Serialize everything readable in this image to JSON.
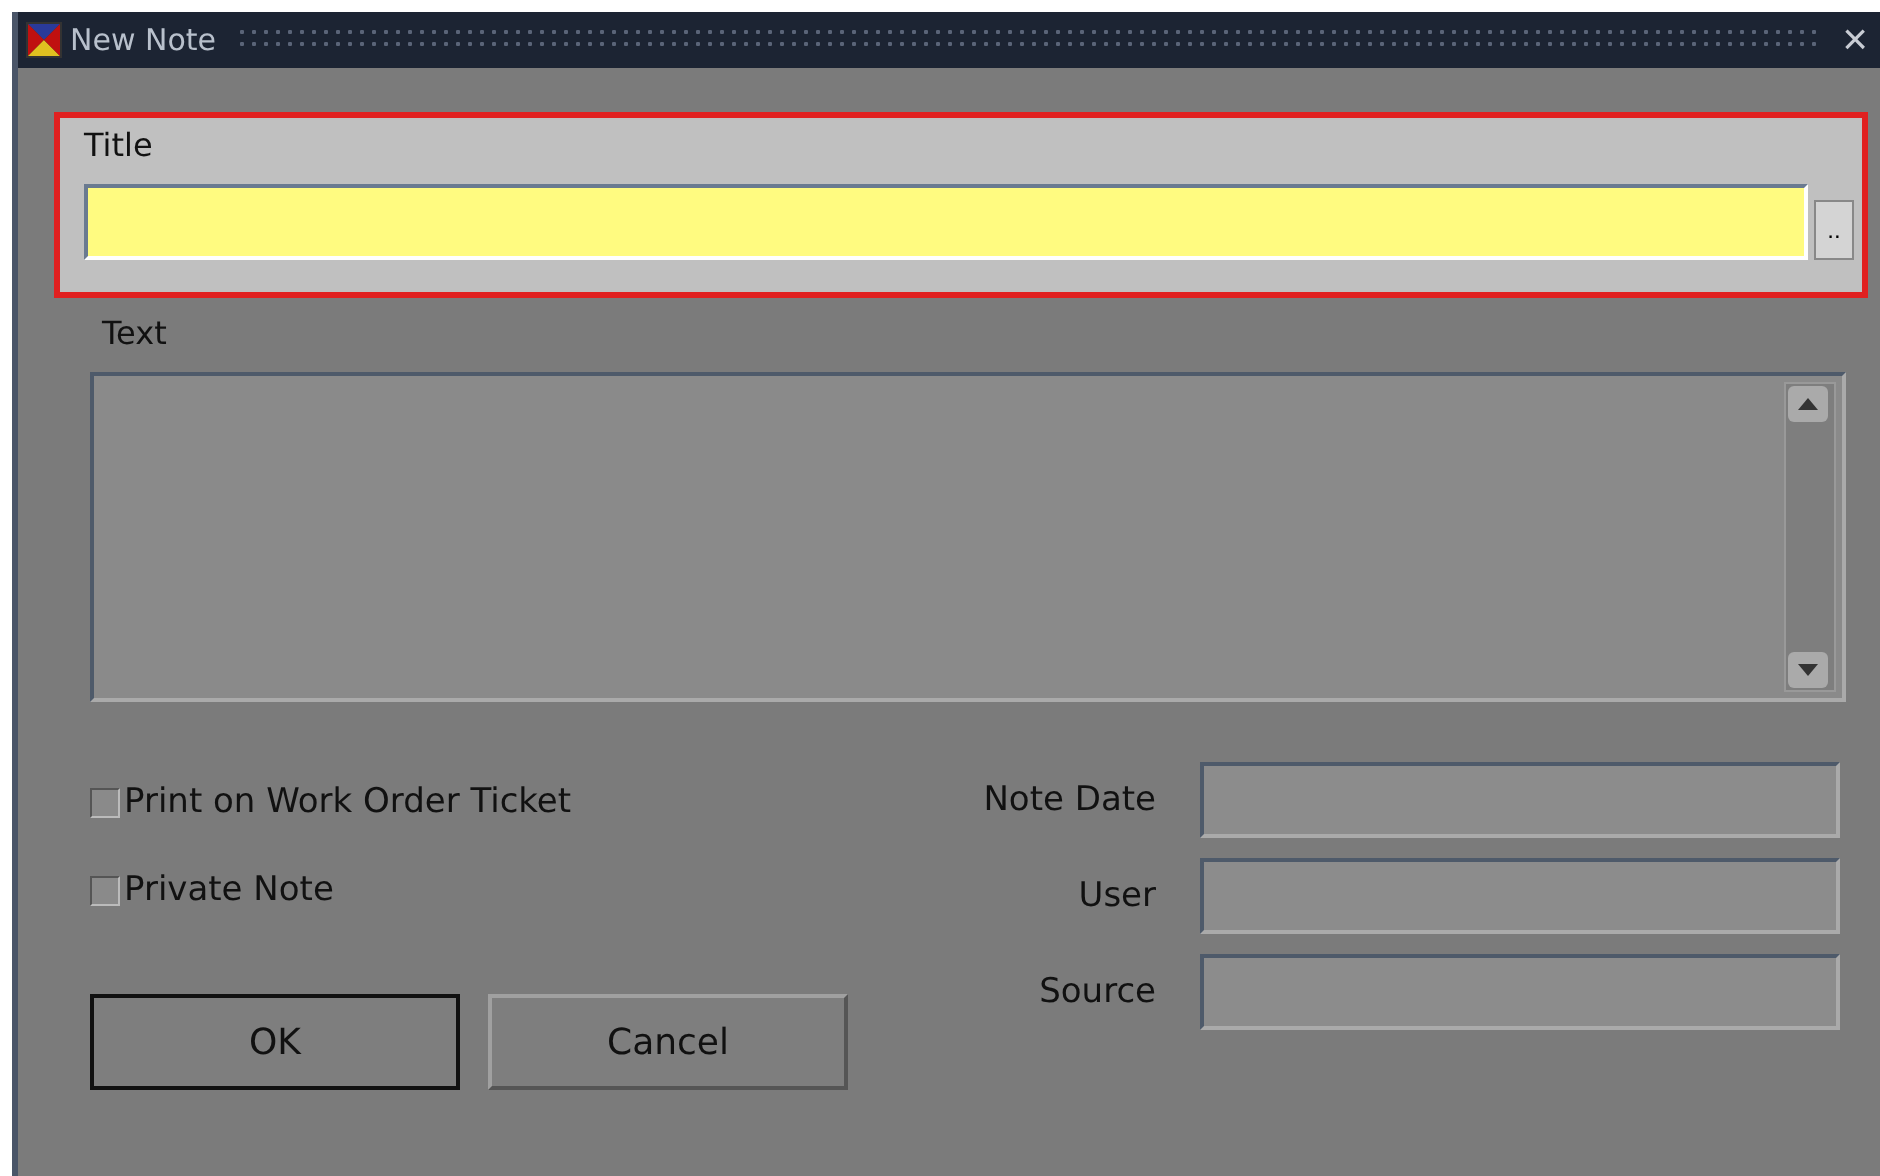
{
  "window": {
    "title": "New Note",
    "close": "×"
  },
  "title_field": {
    "label": "Title",
    "highlighted": true,
    "lookup": ".."
  },
  "text_field": {
    "label": "Text"
  },
  "checkboxes": [
    {
      "label": "Print on Work Order Ticket",
      "checked": false
    },
    {
      "label": "Private Note",
      "checked": false
    }
  ],
  "info_fields": [
    {
      "label": "Note Date"
    },
    {
      "label": "User"
    },
    {
      "label": "Source"
    }
  ],
  "buttons": [
    {
      "label": "OK",
      "default": true
    },
    {
      "label": "Cancel",
      "default": false
    }
  ]
}
